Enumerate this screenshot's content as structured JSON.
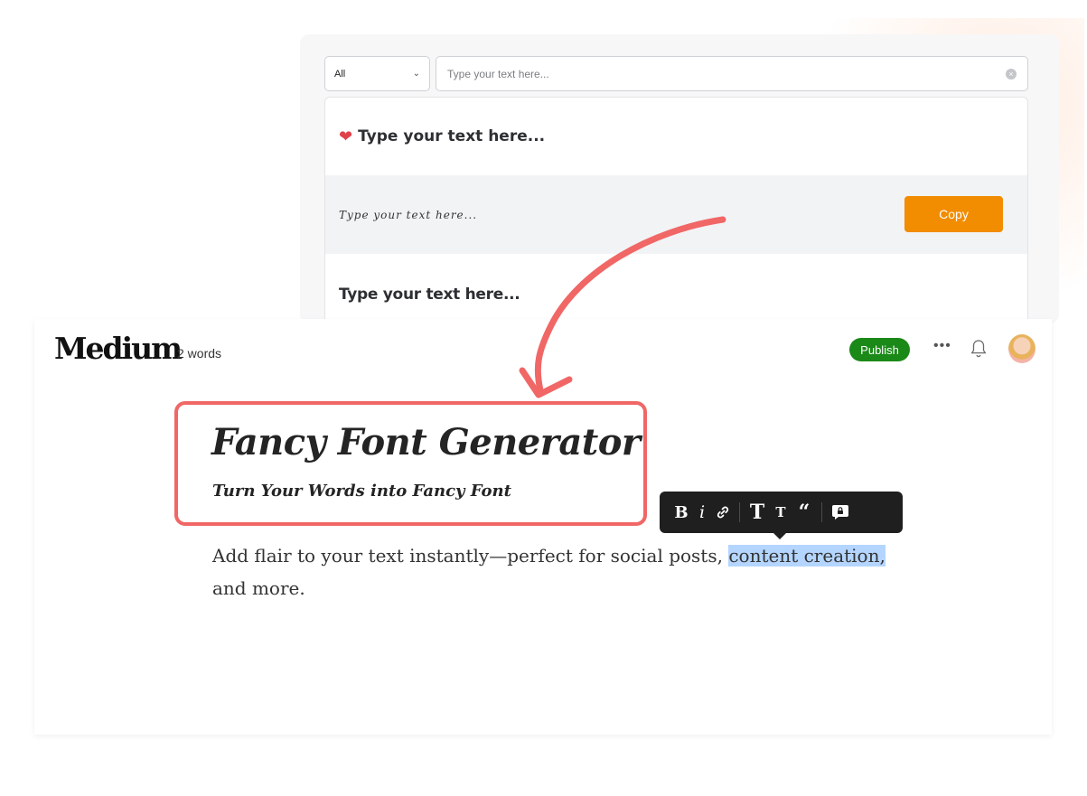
{
  "generator": {
    "category_select": {
      "value": "All"
    },
    "text_input": {
      "placeholder": "Type your text here..."
    },
    "results": [
      {
        "text": "Type your text here...",
        "style": "bold-rounded",
        "icon": "heart-fire-icon"
      },
      {
        "text": "Type your text here...",
        "style": "handwritten",
        "copy_label": "Copy"
      },
      {
        "text": "Type your text here...",
        "style": "bubbly-bold"
      }
    ],
    "colors": {
      "copy_button": "#f28c00"
    }
  },
  "medium": {
    "logo": "Medium",
    "word_count": "2 words",
    "publish_label": "Publish",
    "title": "Fancy Font Generator",
    "subtitle": "Turn Your Words into Fancy Font",
    "body_before": "Add flair to your text instantly—perfect for social posts, ",
    "body_highlight": "content creation,",
    "body_after": " and more.",
    "toolbar": {
      "bold": "B",
      "italic": "i",
      "big_title": "T",
      "small_title": "T",
      "quote": "“"
    },
    "colors": {
      "publish": "#1a8917",
      "title_box": "#f06766",
      "highlight": "#b4d5ff"
    }
  }
}
